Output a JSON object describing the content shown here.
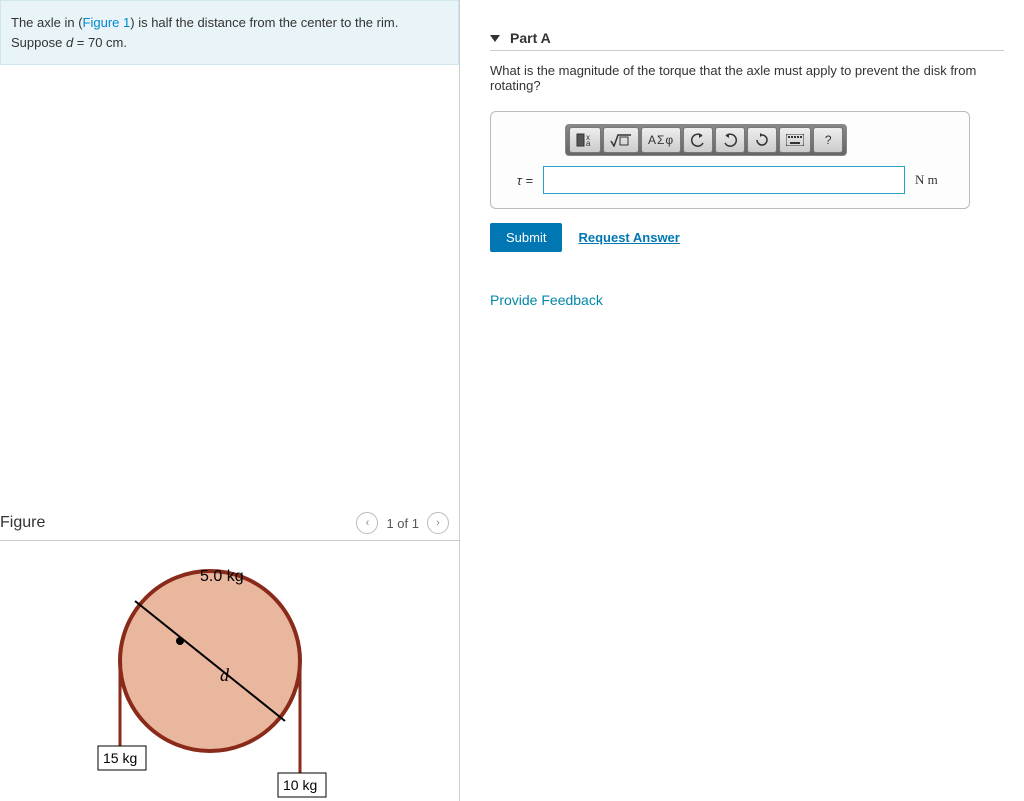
{
  "problem": {
    "pre": "The axle in (",
    "fig_link": "Figure 1",
    "post": ") is half the distance from the center to the rim. Suppose ",
    "var": "d",
    "eq": " = 70 cm."
  },
  "figure": {
    "title": "Figure",
    "nav": "1 of 1",
    "disk_mass": "5.0 kg",
    "d_label": "d",
    "left_mass": "15 kg",
    "right_mass": "10 kg"
  },
  "part": {
    "title": "Part A",
    "question": "What is the magnitude of the torque that the axle must apply to prevent the disk from rotating?",
    "toolbar": {
      "templates_title": "Templates",
      "greek": "ΑΣφ",
      "help": "?"
    },
    "tau": "τ =",
    "units": "N m",
    "submit": "Submit",
    "request": "Request Answer"
  },
  "feedback": "Provide Feedback"
}
